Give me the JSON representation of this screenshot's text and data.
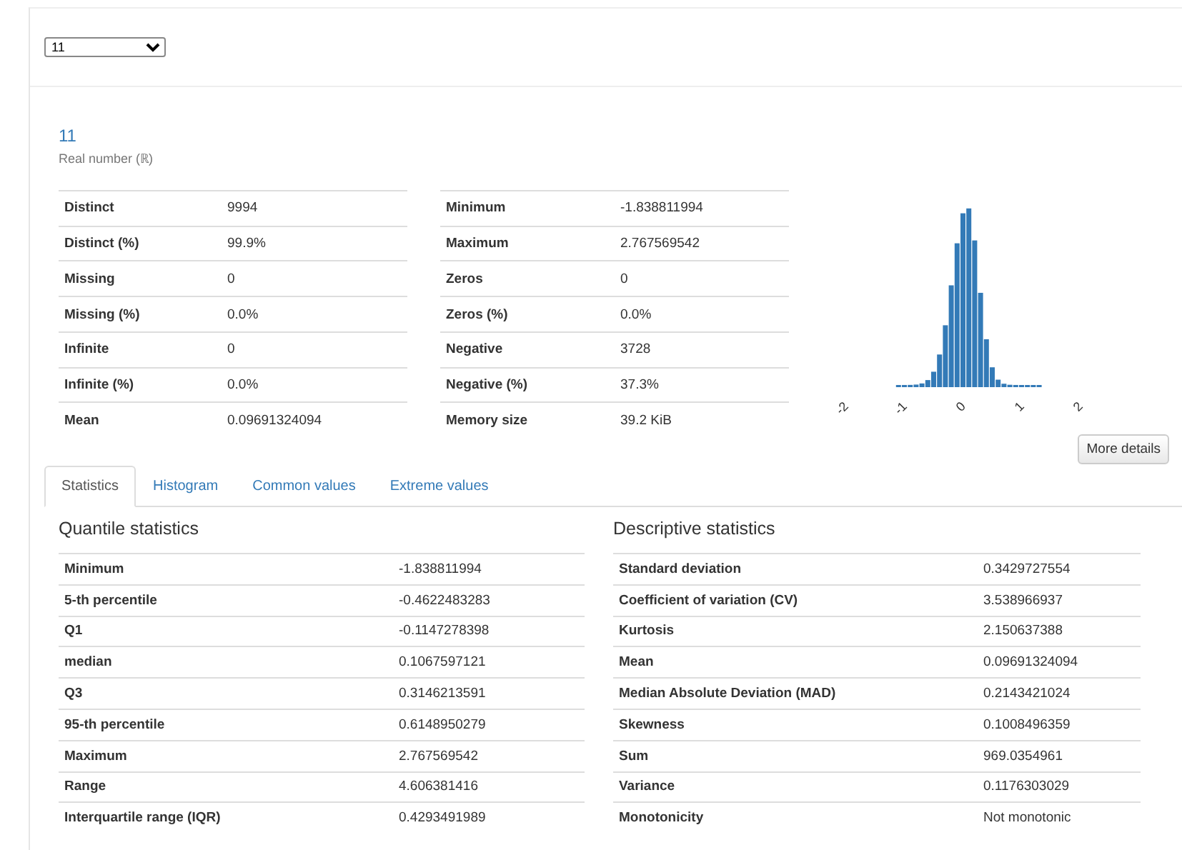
{
  "selector": {
    "value": "11"
  },
  "variable": {
    "name": "11",
    "type": "Real number (ℝ)"
  },
  "overview_left": [
    {
      "label": "Distinct",
      "value": "9994"
    },
    {
      "label": "Distinct (%)",
      "value": "99.9%"
    },
    {
      "label": "Missing",
      "value": "0"
    },
    {
      "label": "Missing (%)",
      "value": "0.0%"
    },
    {
      "label": "Infinite",
      "value": "0"
    },
    {
      "label": "Infinite (%)",
      "value": "0.0%"
    },
    {
      "label": "Mean",
      "value": "0.09691324094"
    }
  ],
  "overview_right": [
    {
      "label": "Minimum",
      "value": "-1.838811994"
    },
    {
      "label": "Maximum",
      "value": "2.767569542"
    },
    {
      "label": "Zeros",
      "value": "0"
    },
    {
      "label": "Zeros (%)",
      "value": "0.0%"
    },
    {
      "label": "Negative",
      "value": "3728"
    },
    {
      "label": "Negative (%)",
      "value": "37.3%"
    },
    {
      "label": "Memory size",
      "value": "39.2 KiB"
    }
  ],
  "mini_histogram": {
    "axis_labels": [
      "-2",
      "-1",
      "0",
      "1",
      "2"
    ]
  },
  "more_details_button": "More details",
  "tabs": [
    {
      "label": "Statistics",
      "selected": true
    },
    {
      "label": "Histogram",
      "selected": false
    },
    {
      "label": "Common values",
      "selected": false
    },
    {
      "label": "Extreme values",
      "selected": false
    }
  ],
  "quantile_statistics": {
    "title": "Quantile statistics",
    "rows": [
      {
        "label": "Minimum",
        "value": "-1.838811994"
      },
      {
        "label": "5-th percentile",
        "value": "-0.4622483283"
      },
      {
        "label": "Q1",
        "value": "-0.1147278398"
      },
      {
        "label": "median",
        "value": "0.1067597121"
      },
      {
        "label": "Q3",
        "value": "0.3146213591"
      },
      {
        "label": "95-th percentile",
        "value": "0.6148950279"
      },
      {
        "label": "Maximum",
        "value": "2.767569542"
      },
      {
        "label": "Range",
        "value": "4.606381416"
      },
      {
        "label": "Interquartile range (IQR)",
        "value": "0.4293491989"
      }
    ]
  },
  "descriptive_statistics": {
    "title": "Descriptive statistics",
    "rows": [
      {
        "label": "Standard deviation",
        "value": "0.3429727554"
      },
      {
        "label": "Coefficient of variation (CV)",
        "value": "3.538966937"
      },
      {
        "label": "Kurtosis",
        "value": "2.150637388"
      },
      {
        "label": "Mean",
        "value": "0.09691324094"
      },
      {
        "label": "Median Absolute Deviation (MAD)",
        "value": "0.2143421024"
      },
      {
        "label": "Skewness",
        "value": "0.1008496359"
      },
      {
        "label": "Sum",
        "value": "969.0354961"
      },
      {
        "label": "Variance",
        "value": "0.1176303029"
      },
      {
        "label": "Monotonicity",
        "value": "Not monotonic"
      }
    ]
  }
}
